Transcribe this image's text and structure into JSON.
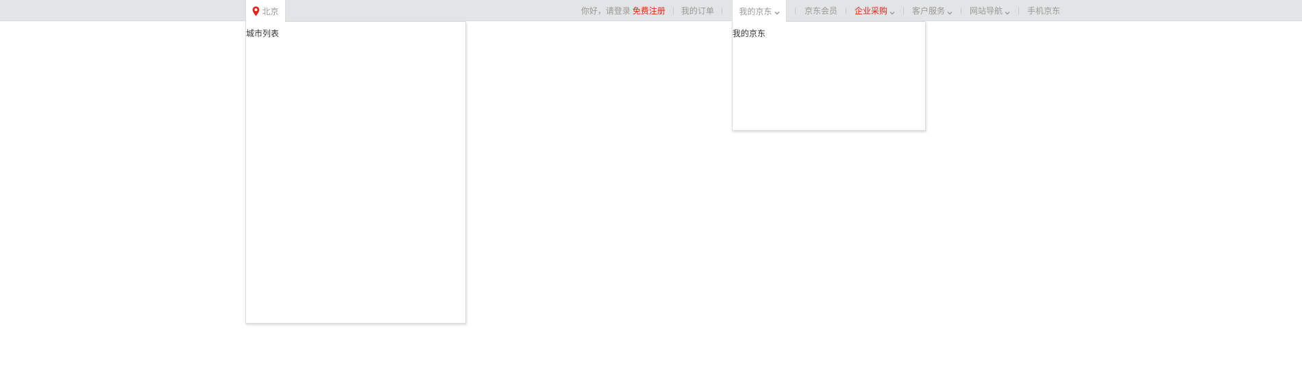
{
  "location": {
    "city": "北京",
    "icon": "location-pin-icon"
  },
  "nav": {
    "greeting": "你好，请登录",
    "register": "免费注册",
    "orders": "我的订单",
    "my_jd": "我的京东",
    "member": "京东会员",
    "enterprise": "企业采购",
    "service": "客户服务",
    "site_nav": "网站导航",
    "mobile": "手机京东"
  },
  "dropdowns": {
    "city_list": "城市列表",
    "my_jd_panel": "我的京东"
  },
  "colors": {
    "accent_red": "#e1251b",
    "topbar_bg": "#e3e4e5",
    "text_gray": "#999999"
  }
}
